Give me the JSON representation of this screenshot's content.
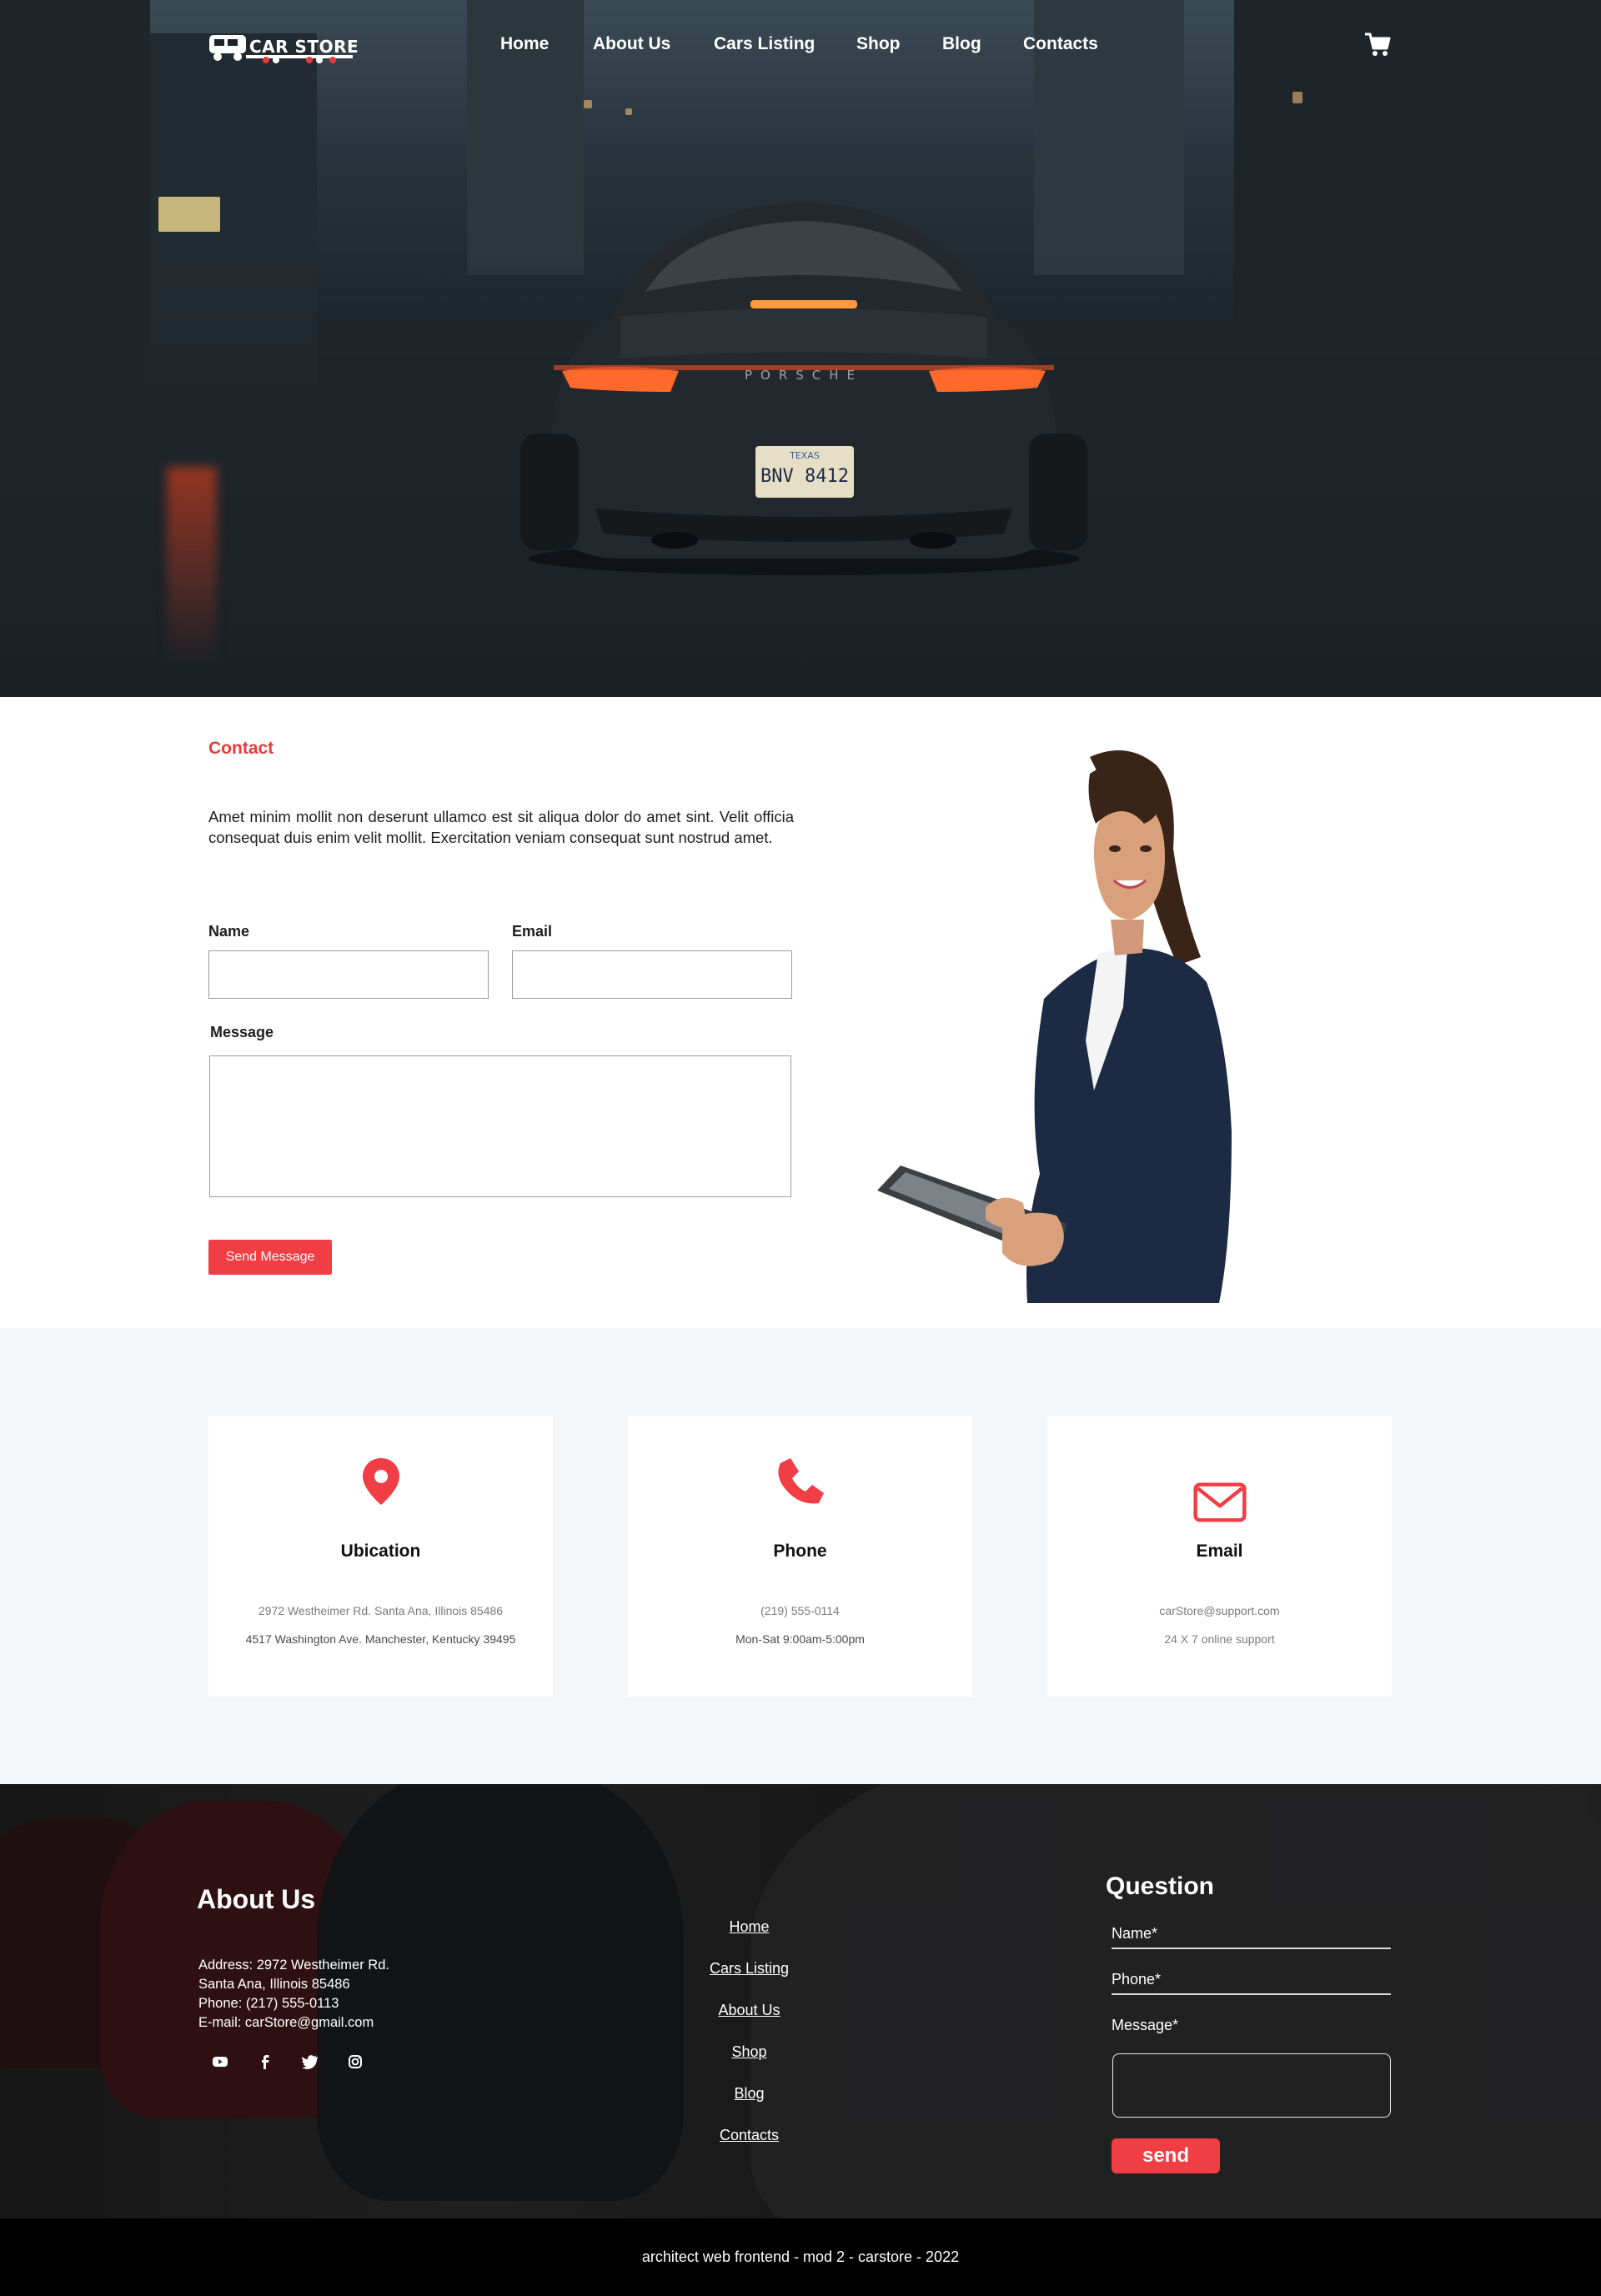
{
  "brand": {
    "logo_text": "CAR STORE"
  },
  "nav": {
    "items": [
      {
        "label": "Home"
      },
      {
        "label": "About Us"
      },
      {
        "label": "Cars Listing"
      },
      {
        "label": "Shop"
      },
      {
        "label": "Blog"
      },
      {
        "label": "Contacts"
      }
    ],
    "cart_icon": "shopping-cart-icon"
  },
  "hero": {
    "plate_state": "TEXAS",
    "plate_number": "BNV 8412",
    "car_brand_text": "PORSCHE"
  },
  "contact": {
    "heading": "Contact",
    "body": "Amet minim mollit non deserunt ullamco est sit aliqua dolor do amet sint. Velit officia consequat duis enim velit mollit. Exercitation veniam consequat sunt nostrud amet.",
    "name_label": "Name",
    "email_label": "Email",
    "message_label": "Message",
    "name_value": "",
    "email_value": "",
    "message_value": "",
    "send_label": "Send Message"
  },
  "info_cards": [
    {
      "icon": "location-pin-icon",
      "title": "Ubication",
      "line1": "2972 Westheimer Rd. Santa Ana, Illinois 85486",
      "line2": "4517 Washington Ave. Manchester, Kentucky 39495"
    },
    {
      "icon": "phone-icon",
      "title": "Phone",
      "line1": "(219) 555-0114",
      "line2": "Mon-Sat 9:00am-5:00pm"
    },
    {
      "icon": "envelope-icon",
      "title": "Email",
      "line1": "carStore@support.com",
      "line2": "24 X 7 online support"
    }
  ],
  "footer": {
    "about_title": "About Us",
    "address_lines": [
      "Address: 2972 Westheimer Rd.",
      "Santa Ana, Illinois 85486",
      "Phone:  (217) 555-0113",
      "E-mail: carStore@gmail.com"
    ],
    "social_icons": [
      "youtube-icon",
      "facebook-icon",
      "twitter-icon",
      "instagram-icon"
    ],
    "links": [
      "Home",
      "Cars Listing",
      "About Us",
      "Shop",
      "Blog",
      "Contacts"
    ],
    "question_title": "Question",
    "name_label": "Name*",
    "phone_label": "Phone*",
    "message_label": "Message*",
    "send_label": "send"
  },
  "bottom_bar": {
    "text": "architect web frontend - mod 2 -  carstore - 2022"
  },
  "colors": {
    "accent": "#f03e44",
    "heading_red": "#e63b3b",
    "footer_bottom": "#000000",
    "info_bg": "#f5f6f8"
  }
}
